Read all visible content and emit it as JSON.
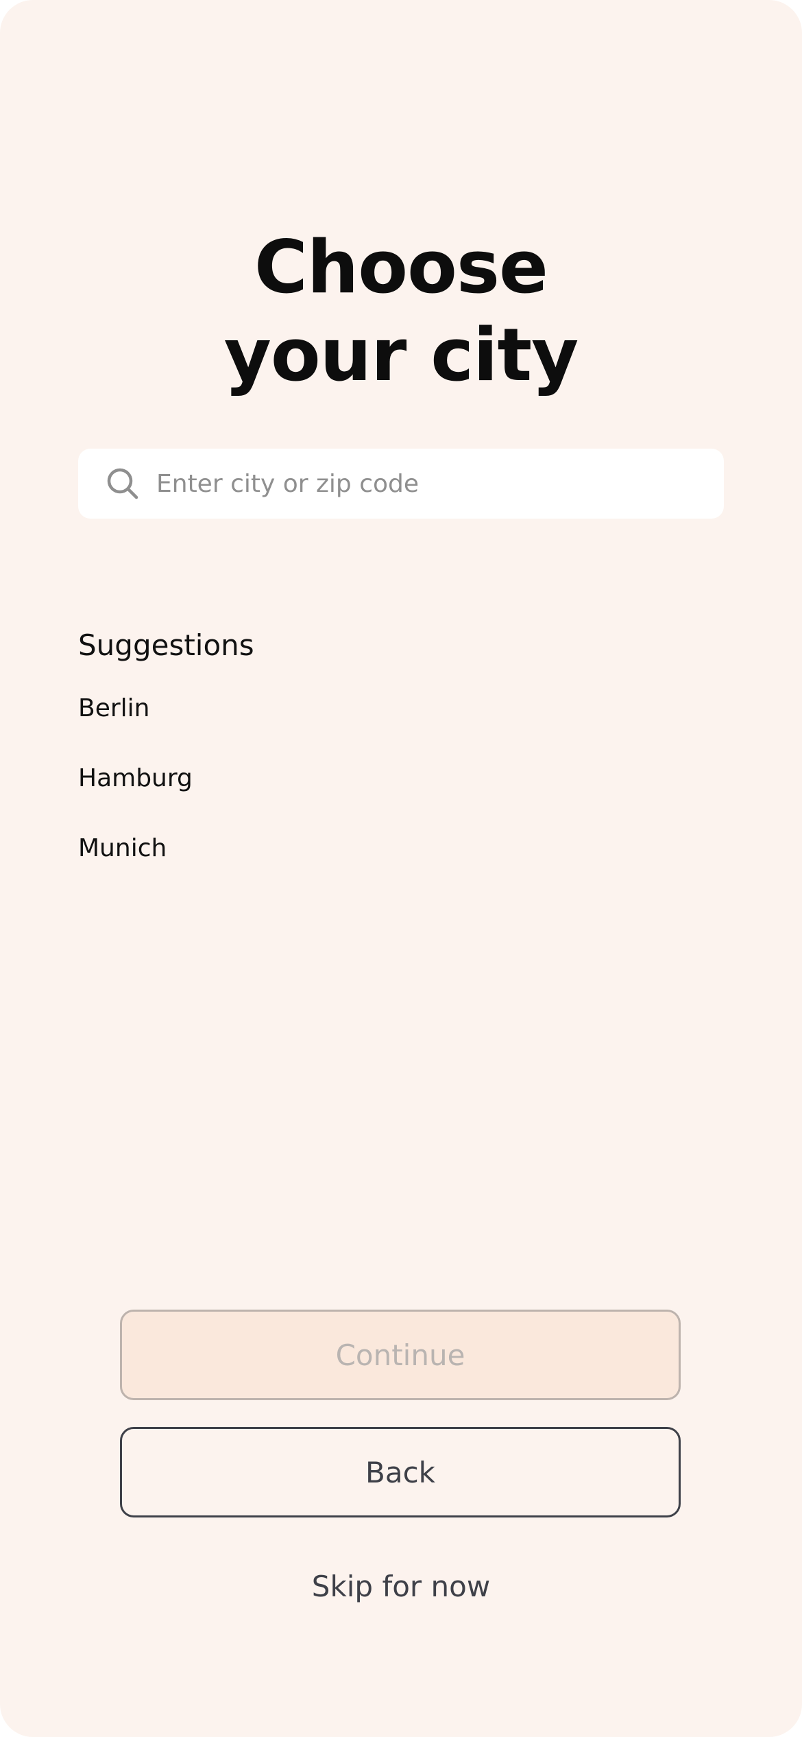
{
  "title": {
    "line1": "Choose",
    "line2": "your city"
  },
  "search": {
    "icon": "search-icon",
    "value": "",
    "placeholder": "Enter city or zip code"
  },
  "suggestions": {
    "heading": "Suggestions",
    "items": [
      "Berlin",
      "Hamburg",
      "Munich"
    ]
  },
  "actions": {
    "continue_label": "Continue",
    "back_label": "Back",
    "skip_label": "Skip for now"
  },
  "colors": {
    "background": "#fcf3ee",
    "continue_fill": "#fae8dc",
    "button_outline": "#3e4048",
    "placeholder_text": "#8f8f8f"
  }
}
